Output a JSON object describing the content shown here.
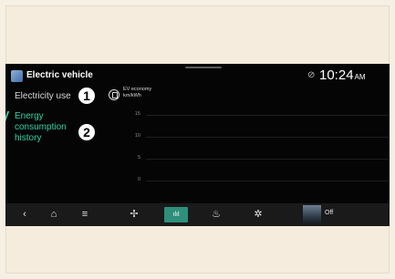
{
  "header": {
    "app_title": "Electric vehicle",
    "time": "10:24",
    "ampm": "AM",
    "status_icon": "signal-icon"
  },
  "menu": {
    "items": [
      {
        "label": "Electricity use",
        "callout": "1"
      },
      {
        "label": "Energy consumption history",
        "callout": "2",
        "active": true
      }
    ]
  },
  "ev_economy": {
    "title": "EV economy",
    "unit": "km/kWh",
    "icon": "ev-gauge-icon"
  },
  "chart_data": {
    "type": "bar",
    "title": "",
    "xlabel": "",
    "ylabel": "km/kWh",
    "yticks": [
      15,
      10,
      5,
      0
    ],
    "ylim": [
      0,
      15
    ],
    "categories": [],
    "values": [],
    "grid": true
  },
  "dock": {
    "items": [
      {
        "name": "back-icon",
        "glyph": "‹"
      },
      {
        "name": "home-icon",
        "glyph": "⌂"
      },
      {
        "name": "menu-icon",
        "glyph": "≡"
      },
      {
        "name": "fan-icon",
        "glyph": "✢"
      },
      {
        "name": "energy-chart-icon",
        "glyph": "ılıl",
        "active": true
      },
      {
        "name": "seat-heat-icon",
        "glyph": "♨"
      },
      {
        "name": "settings-gear-icon",
        "glyph": "✲"
      }
    ],
    "media_status": "Off"
  },
  "colors": {
    "accent": "#2fd2a6",
    "active_tab": "#2e8f7b",
    "screen_bg": "#050505",
    "page_bg": "#f5ecdd"
  }
}
